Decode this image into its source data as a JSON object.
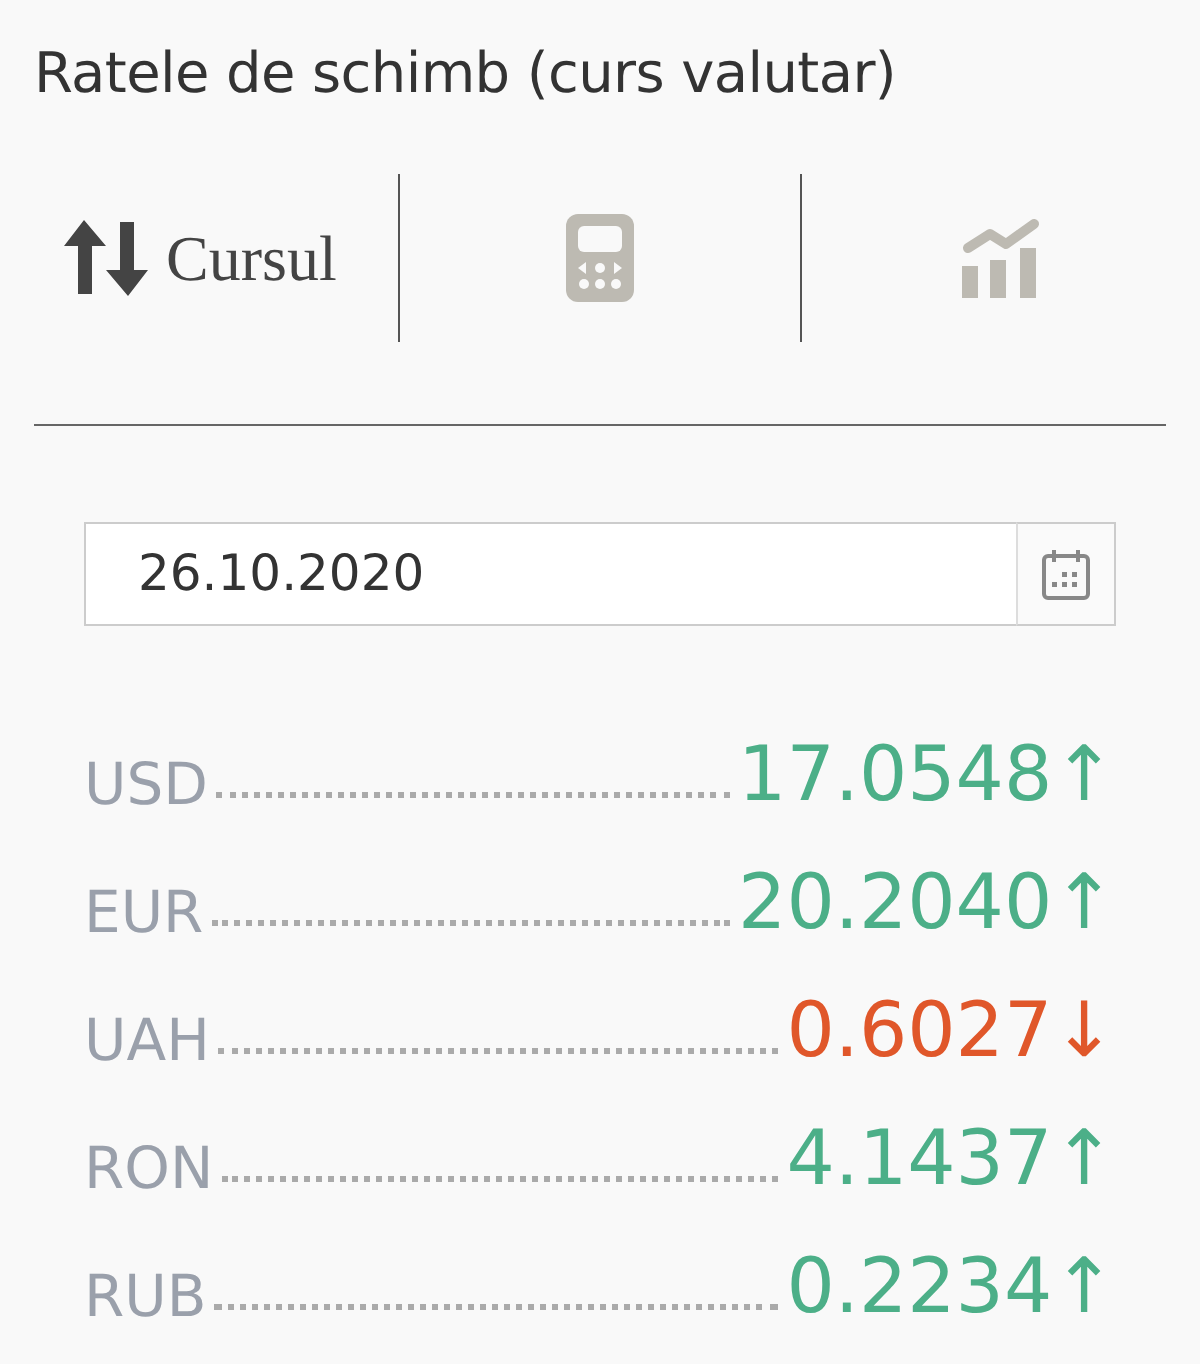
{
  "title": "Ratele de schimb (curs valutar)",
  "tabs": [
    {
      "kind": "arrows",
      "label": "Cursul",
      "selected": true
    },
    {
      "kind": "calculator",
      "selected": false
    },
    {
      "kind": "chart",
      "selected": false
    }
  ],
  "date_field": {
    "value": "26.10.2020"
  },
  "rates": [
    {
      "code": "USD",
      "value": "17.0548",
      "arrow": "↑",
      "color": "#4caf88"
    },
    {
      "code": "EUR",
      "value": "20.2040",
      "arrow": "↑",
      "color": "#4caf88"
    },
    {
      "code": "UAH",
      "value": "0.6027",
      "arrow": "↓",
      "color": "#e0572a"
    },
    {
      "code": "RON",
      "value": "4.1437",
      "arrow": "↑",
      "color": "#4caf88"
    },
    {
      "code": "RUB",
      "value": "0.2234",
      "arrow": "↑",
      "color": "#4caf88"
    }
  ]
}
